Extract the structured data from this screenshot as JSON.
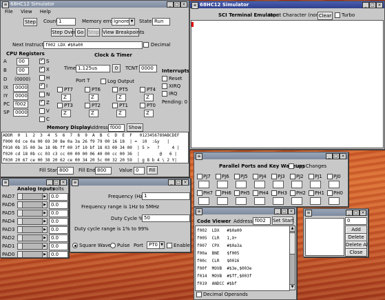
{
  "main": {
    "title": "68HC12 Simulator",
    "menu": [
      "File",
      "View",
      "Help"
    ],
    "step_btn": "Step",
    "count_label": "Count",
    "count_value": "1",
    "memerr_label": "Memory errors",
    "memerr_value": "Ignore",
    "state_label": "State",
    "state_value": "Run",
    "stepover_btn": "Step Over",
    "go_btn": "Go",
    "stop_btn": "Stop",
    "viewbp_btn": "View Breakpoints",
    "next_label": "Next Instruction",
    "next_value": "f002  LDX   #$0a00",
    "decimal_label": "Decimal",
    "cpu_title": "CPU Registers",
    "regs": [
      {
        "name": "A",
        "value": "00"
      },
      {
        "name": "B",
        "value": "00"
      },
      {
        "name": "D",
        "value": "(0000)"
      },
      {
        "name": "IX",
        "value": "0000"
      },
      {
        "name": "IY",
        "value": "0000"
      },
      {
        "name": "PC",
        "value": "f002"
      },
      {
        "name": "SP",
        "value": "0000"
      }
    ],
    "flags": [
      "S",
      "X",
      "H",
      "I",
      "N",
      "Z",
      "V",
      "C"
    ],
    "clock_title": "Clock & Timer",
    "time_label": "Time",
    "time_value": "1.125us",
    "zero_btn": "0",
    "tcnt_label": "TCNT",
    "tcnt_value": "0000",
    "interrupts_title": "Interrupts",
    "int_reset": "Reset",
    "int_xirq": "XIRQ",
    "int_irq": "IRQ",
    "pending": "Pending: 0",
    "portt_title": "Port T",
    "log_output": "Log Output",
    "pt_row1": [
      "PT7",
      "PT6",
      "PT5",
      "PT4"
    ],
    "pt_row2": [
      "PT3",
      "PT2",
      "PT1",
      "PT0"
    ],
    "pt_value": "Z",
    "memdisp_title": "Memory Display",
    "address_label": "Address",
    "address_value": "f000",
    "show_btn": "Show",
    "mem_header": "ADDR  0  1  2  3  4  5  6  7  8  9  A  B  C  D  E  F   0123456789ABCDEF",
    "mem_rows": [
      "f000 0d ce 0a 00 69 30 8e 0a 3a 26 f9 79 00 16 18  | =  i0  :&y   |",
      "f010 0b 35 00 3e 18 0b ff 00 3f 10 bf 18 03 00 34 00  | 5 >   ?     4 |",
      "f020 cd 18 0b cc 03 c3 cc 00 00 00 06 40 00 cc 00 36  |        @   6 |",
      "f030 20 67 ce 00 38 20 62 ce 00 34 20 5c 00 32 20 59  | g 8 b 4 \\ 2 Y|"
    ],
    "fill_start_label": "Fill Start",
    "fill_start_value": "800",
    "fill_end_label": "Fill End",
    "fill_end_value": "800",
    "value_label": "Value",
    "value_value": "0",
    "fill_btn": "Fill"
  },
  "sci": {
    "title": "68HC12 Simulator",
    "label": "SCI Terminal Emulator",
    "input_char": "Input Character (none)",
    "clear_btn": "Clear",
    "turbo_label": "Turbo"
  },
  "ppkw": {
    "title": "Parallel Ports and Key Wakeups",
    "log_changes": "Log Changes",
    "row1": [
      "PJ7",
      "PJ6",
      "PJ5",
      "PJ4",
      "PJ3",
      "PJ2",
      "PJ1",
      "PJ0"
    ],
    "row2": [
      "PH7",
      "PH6",
      "PH5",
      "PH4",
      "PH3",
      "PH2",
      "PH1",
      "PH0"
    ]
  },
  "analog": {
    "title": "Analog Inputs",
    "header": "Analog Inputs",
    "volts": "volts",
    "pads": [
      {
        "name": "PAD7",
        "value": "0.0"
      },
      {
        "name": "PAD6",
        "value": "0.0"
      },
      {
        "name": "PAD5",
        "value": "0.0"
      },
      {
        "name": "PAD4",
        "value": "0.0"
      },
      {
        "name": "PAD3",
        "value": "0.0"
      },
      {
        "name": "PAD2",
        "value": "0.0"
      },
      {
        "name": "PAD1",
        "value": "0.0"
      },
      {
        "name": "PAD0",
        "value": "0.0"
      }
    ]
  },
  "pulse": {
    "title": "Pulse Generator",
    "freq_label": "Frequency (Hz)",
    "freq_value": "1",
    "freq_range": "Frequency range is 1Hz to 5MHz",
    "duty_label": "Duty Cycle %",
    "duty_value": "50",
    "duty_range": "Duty cycle range is 1% to 99%",
    "square": "Square Wave",
    "pulse": "Pulse",
    "port_label": "Port",
    "port_value": "PT0",
    "enable_label": "Enable"
  },
  "code": {
    "title": "Code Viewer",
    "header": "Code Viewer",
    "address_label": "Address",
    "address_value": "f002",
    "setstart_btn": "Set Start",
    "lines": [
      "f002  LDX   #$0a00",
      "f005  CLR   1,X+",
      "f007  CPX   #$0a3a",
      "f00a  BNE   $f005",
      "f00c  CLR   $0016",
      "f00f  MOVB  #$3e,$003e",
      "f014  MOVB  #$ff,$003f",
      "f019  ANDCC #$bf"
    ],
    "decimal_operands": "Decimal Operands"
  },
  "bp": {
    "title": "Breakpoints",
    "input_value": "0",
    "add": "Add",
    "delete": "Delete",
    "delete_all": "Delete All",
    "close": "Close"
  }
}
